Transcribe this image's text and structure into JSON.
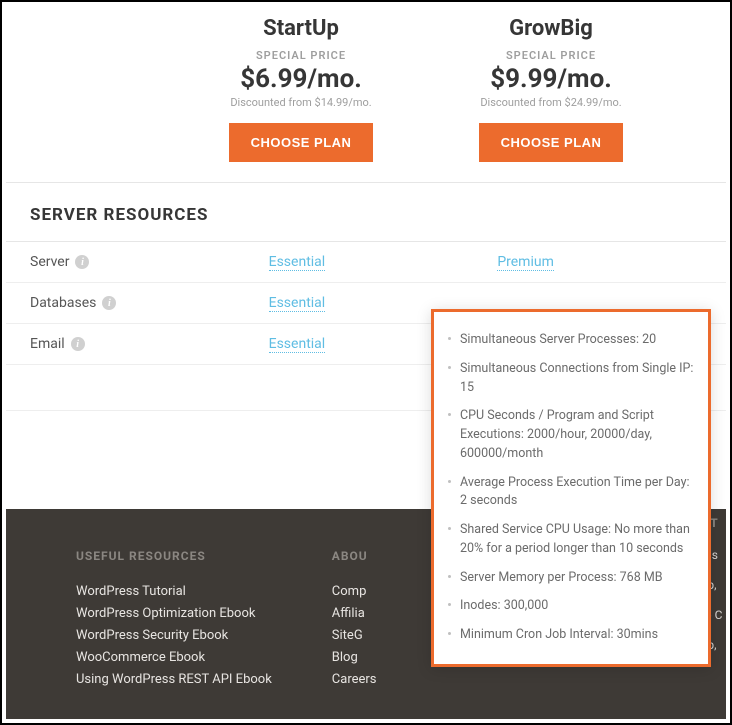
{
  "plans": [
    {
      "name": "StartUp",
      "special_label": "SPECIAL PRICE",
      "price": "$6.99/mo.",
      "discount": "Discounted from $14.99/mo.",
      "button": "CHOOSE PLAN"
    },
    {
      "name": "GrowBig",
      "special_label": "SPECIAL PRICE",
      "price": "$9.99/mo.",
      "discount": "Discounted from $24.99/mo.",
      "button": "CHOOSE PLAN"
    }
  ],
  "section_title": "SERVER RESOURCES",
  "resources": [
    {
      "label": "Server",
      "val1": "Essential",
      "val2": "Premium"
    },
    {
      "label": "Databases",
      "val1": "Essential",
      "val2": ""
    },
    {
      "label": "Email",
      "val1": "Essential",
      "val2": ""
    }
  ],
  "tooltip_items": [
    "Simultaneous Server Processes: 20",
    "Simultaneous Connections from Single IP: 15",
    "CPU Seconds / Program and Script Executions: 2000/hour, 20000/day, 600000/month",
    "Average Process Execution Time per Day: 2 seconds",
    "Shared Service CPU Usage: No more than 20% for a period longer than 10 seconds",
    "Server Memory per Process: 768 MB",
    "Inodes: 300,000",
    "Minimum Cron Job Interval: 30mins"
  ],
  "footer": {
    "col1": {
      "title": "USEFUL RESOURCES",
      "links": [
        "WordPress Tutorial",
        "WordPress Optimization Ebook",
        "WordPress Security Ebook",
        "WooCommerce Ebook",
        "Using WordPress REST API Ebook"
      ]
    },
    "col2": {
      "title": "ABOU",
      "links": [
        "Comp",
        "Affilia",
        "SiteG",
        "Blog",
        "Careers"
      ]
    },
    "col3": {
      "title": "NT",
      "links": [
        "fas",
        "ep,",
        "to C",
        "ep,"
      ]
    }
  }
}
